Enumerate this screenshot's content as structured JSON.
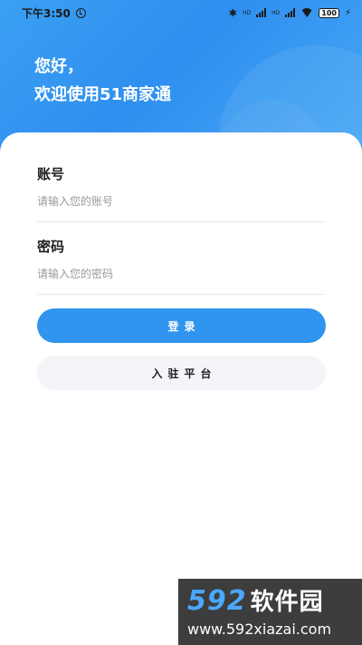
{
  "status_bar": {
    "time": "下午3:50",
    "bluetooth": "✱",
    "signal1_label": "HD",
    "signal2_label": "HD",
    "battery": "100",
    "charge": "⚡"
  },
  "header": {
    "line1": "您好，",
    "line2": "欢迎使用51商家通"
  },
  "form": {
    "account_label": "账号",
    "account_placeholder": "请输入您的账号",
    "password_label": "密码",
    "password_placeholder": "请输入您的密码"
  },
  "buttons": {
    "login": "登录",
    "join": "入驻平台"
  },
  "watermark": {
    "logo_number": "592",
    "logo_text": "软件园",
    "url": "www.592xiazai.com"
  },
  "colors": {
    "primary": "#2f95ee",
    "header_gradient": "#3aa0f2",
    "secondary_button": "#f3f5f8"
  }
}
